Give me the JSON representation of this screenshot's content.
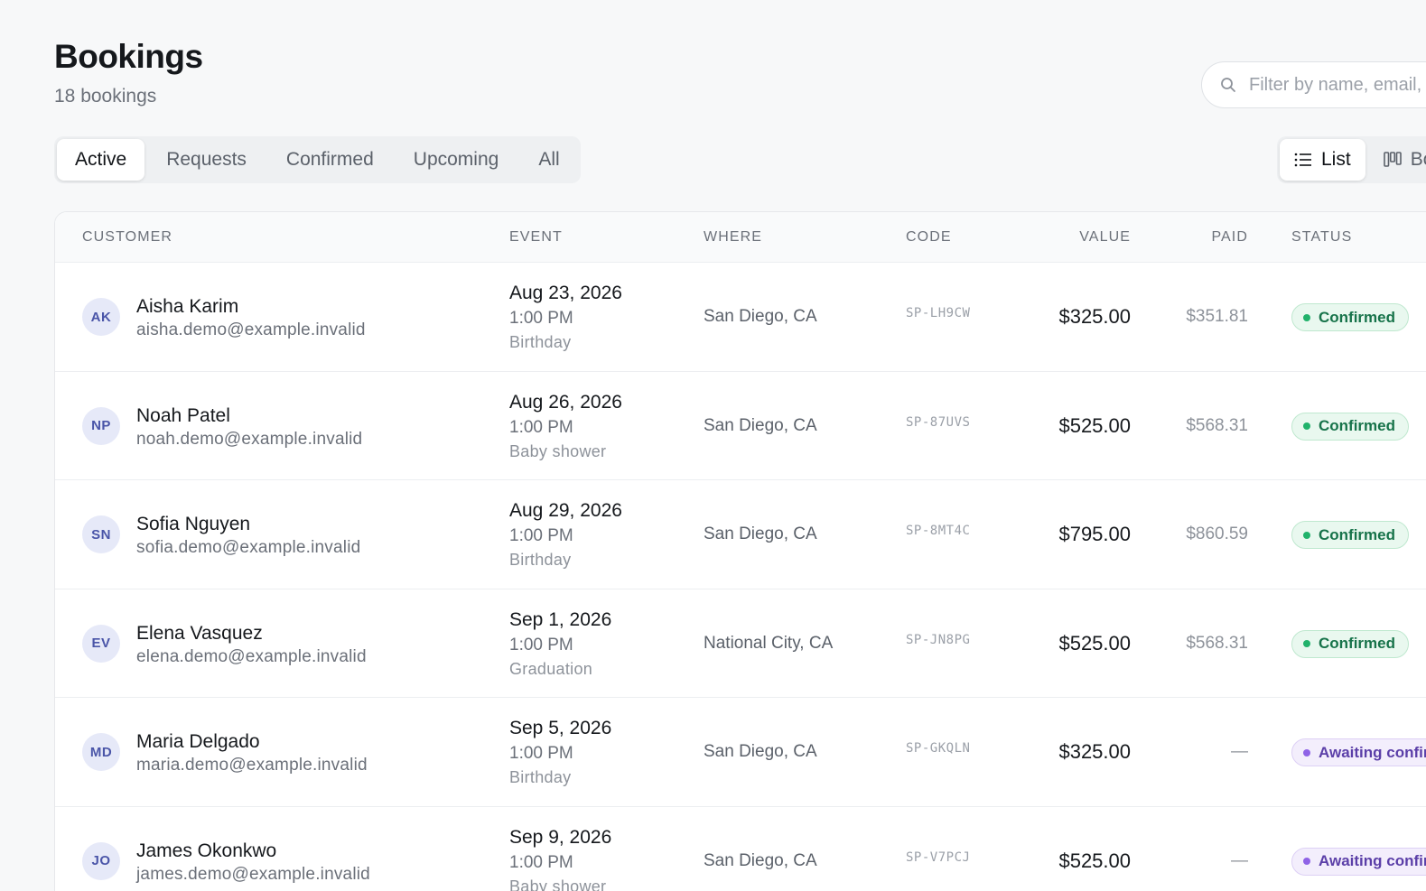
{
  "header": {
    "title": "Bookings",
    "subtitle": "18 bookings"
  },
  "search": {
    "placeholder": "Filter by name, email, code…",
    "icon": "search-icon"
  },
  "tabs": [
    {
      "label": "Active",
      "active": true
    },
    {
      "label": "Requests",
      "active": false
    },
    {
      "label": "Confirmed",
      "active": false
    },
    {
      "label": "Upcoming",
      "active": false
    },
    {
      "label": "All",
      "active": false
    }
  ],
  "view_toggle": {
    "list_label": "List",
    "board_label": "Board"
  },
  "table": {
    "columns": {
      "customer": "CUSTOMER",
      "event": "EVENT",
      "where": "WHERE",
      "code": "CODE",
      "value": "VALUE",
      "paid": "PAID",
      "status": "STATUS"
    },
    "rows": [
      {
        "initials": "AK",
        "name": "Aisha Karim",
        "email": "aisha.demo@example.invalid",
        "date": "Aug 23, 2026",
        "time": "1:00 PM",
        "type": "Birthday",
        "where": "San Diego, CA",
        "code": "SP-LH9CW",
        "value": "$325.00",
        "paid": "$351.81",
        "status": "Confirmed",
        "status_kind": "confirmed"
      },
      {
        "initials": "NP",
        "name": "Noah Patel",
        "email": "noah.demo@example.invalid",
        "date": "Aug 26, 2026",
        "time": "1:00 PM",
        "type": "Baby shower",
        "where": "San Diego, CA",
        "code": "SP-87UVS",
        "value": "$525.00",
        "paid": "$568.31",
        "status": "Confirmed",
        "status_kind": "confirmed"
      },
      {
        "initials": "SN",
        "name": "Sofia Nguyen",
        "email": "sofia.demo@example.invalid",
        "date": "Aug 29, 2026",
        "time": "1:00 PM",
        "type": "Birthday",
        "where": "San Diego, CA",
        "code": "SP-8MT4C",
        "value": "$795.00",
        "paid": "$860.59",
        "status": "Confirmed",
        "status_kind": "confirmed"
      },
      {
        "initials": "EV",
        "name": "Elena Vasquez",
        "email": "elena.demo@example.invalid",
        "date": "Sep 1, 2026",
        "time": "1:00 PM",
        "type": "Graduation",
        "where": "National City, CA",
        "code": "SP-JN8PG",
        "value": "$525.00",
        "paid": "$568.31",
        "status": "Confirmed",
        "status_kind": "confirmed"
      },
      {
        "initials": "MD",
        "name": "Maria Delgado",
        "email": "maria.demo@example.invalid",
        "date": "Sep 5, 2026",
        "time": "1:00 PM",
        "type": "Birthday",
        "where": "San Diego, CA",
        "code": "SP-GKQLN",
        "value": "$325.00",
        "paid": "—",
        "status": "Awaiting confirmation",
        "status_kind": "awaiting"
      },
      {
        "initials": "JO",
        "name": "James Okonkwo",
        "email": "james.demo@example.invalid",
        "date": "Sep 9, 2026",
        "time": "1:00 PM",
        "type": "Baby shower",
        "where": "San Diego, CA",
        "code": "SP-V7PCJ",
        "value": "$525.00",
        "paid": "—",
        "status": "Awaiting confirmation",
        "status_kind": "awaiting"
      }
    ]
  },
  "colors": {
    "confirmed_bg": "#e9f8ef",
    "confirmed_border": "#bfe8cf",
    "confirmed_text": "#17734a",
    "confirmed_dot": "#21b26b",
    "awaiting_bg": "#f3eefc",
    "awaiting_border": "#ddd0f5",
    "awaiting_text": "#5b3fa8",
    "awaiting_dot": "#8f63e6"
  }
}
